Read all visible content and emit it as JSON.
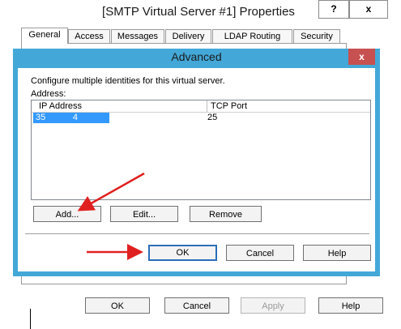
{
  "outer_window": {
    "title": "[SMTP Virtual Server #1] Properties",
    "help_button": "?",
    "close_button": "x",
    "tabs": [
      "General",
      "Access",
      "Messages",
      "Delivery",
      "LDAP Routing",
      "Security"
    ],
    "active_tab": "General",
    "buttons": {
      "ok": "OK",
      "cancel": "Cancel",
      "apply": "Apply",
      "help": "Help"
    }
  },
  "dialog": {
    "title": "Advanced",
    "close_button": "x",
    "description": "Configure multiple identities for this virtual server.",
    "address_label": "Address:",
    "columns": {
      "ip": "IP Address",
      "port": "TCP Port"
    },
    "rows": [
      {
        "ip": "35           4",
        "port": "25"
      }
    ],
    "buttons": {
      "add": "Add...",
      "edit": "Edit...",
      "remove": "Remove",
      "ok": "OK",
      "cancel": "Cancel",
      "help": "Help"
    }
  },
  "colors": {
    "dialog_frame": "#43a8d8",
    "close_red": "#c75050",
    "selection": "#3399ff",
    "annotation_arrow": "#e02020"
  },
  "icons": [
    "close-icon",
    "help-icon",
    "red-arrow-annotation"
  ]
}
